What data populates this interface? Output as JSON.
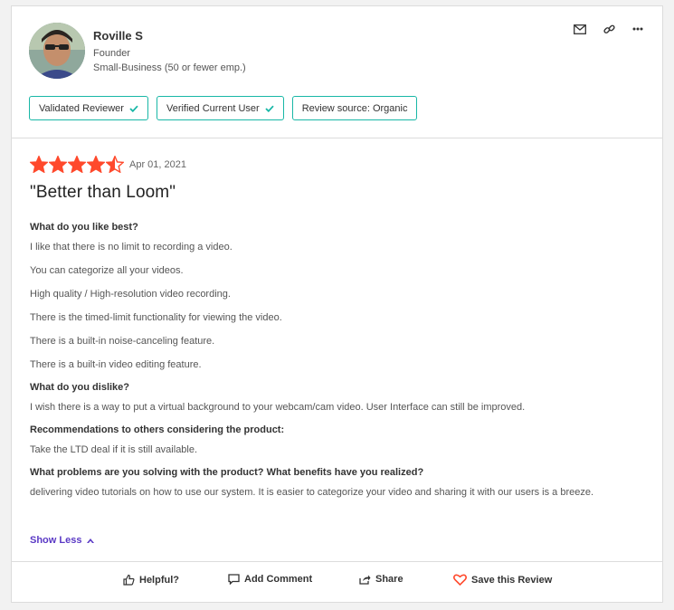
{
  "reviewer": {
    "name": "Roville S",
    "role": "Founder",
    "segment": "Small-Business (50 or fewer emp.)"
  },
  "badges": [
    {
      "label": "Validated Reviewer",
      "check": true
    },
    {
      "label": "Verified Current User",
      "check": true
    },
    {
      "label": "Review source: Organic",
      "check": false
    }
  ],
  "review": {
    "rating": 4.5,
    "date": "Apr 01, 2021",
    "title": "\"Better than Loom\"",
    "sections": [
      {
        "question": "What do you like best?",
        "answers": [
          "I like that there is no limit to recording a video.",
          "You can categorize all your videos.",
          "High quality / High-resolution video recording.",
          "There is the timed-limit functionality for viewing the video.",
          "There is a built-in noise-canceling feature.",
          "There is a built-in video editing feature."
        ]
      },
      {
        "question": "What do you dislike?",
        "answers": [
          "I wish there is a way to put a virtual background to your webcam/cam video. User Interface can still be improved."
        ]
      },
      {
        "question": "Recommendations to others considering the product:",
        "answers": [
          "Take the LTD deal if it is still available."
        ]
      },
      {
        "question": "What problems are you solving with the product? What benefits have you realized?",
        "answers": [
          "delivering video tutorials on how to use our system. It is easier to categorize your video and sharing it with our users is a breeze."
        ]
      }
    ],
    "show_less": "Show Less"
  },
  "footer": {
    "helpful": "Helpful?",
    "add_comment": "Add Comment",
    "share": "Share",
    "save": "Save this Review"
  },
  "colors": {
    "star": "#ff492c",
    "badge_border": "#18b7a6",
    "link": "#5a39c5",
    "heart": "#ff492c"
  }
}
